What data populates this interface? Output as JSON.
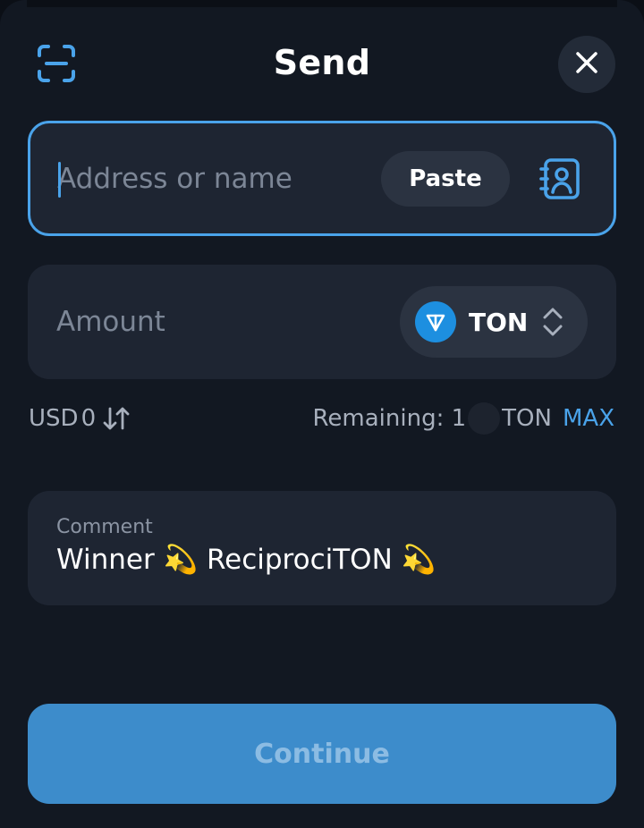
{
  "header": {
    "title": "Send",
    "scan_icon": "qr-scan-icon",
    "close_icon": "close-icon"
  },
  "address": {
    "placeholder": "Address or name",
    "value": "",
    "paste_label": "Paste",
    "contacts_icon": "address-book-icon"
  },
  "amount": {
    "placeholder": "Amount",
    "value": "",
    "token": {
      "symbol": "TON",
      "logo_icon": "ton-logo-icon",
      "selector_icon": "chevron-updown-icon"
    }
  },
  "balance": {
    "fiat_currency": "USD",
    "fiat_value": "0",
    "swap_icon": "swap-arrows-icon",
    "remaining_label": "Remaining: 1",
    "remaining_unit": "TON",
    "max_label": "MAX"
  },
  "comment": {
    "label": "Comment",
    "value": "Winner 💫 ReciprociTON 💫"
  },
  "footer": {
    "continue_label": "Continue"
  },
  "colors": {
    "background": "#121822",
    "card": "#1e2532",
    "accent": "#4aa3ea",
    "button": "#3d8ccb",
    "ton_blue": "#1d8fe0"
  }
}
